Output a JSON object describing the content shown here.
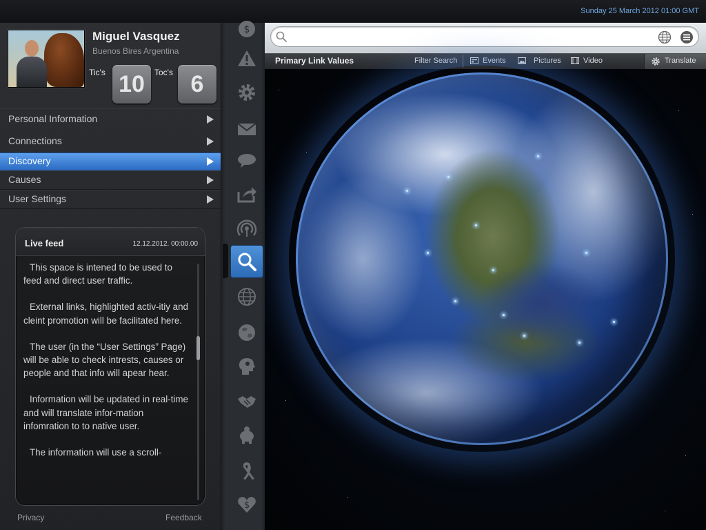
{
  "topbar": {
    "datetime": "Sunday 25 March 2012 01:00 GMT"
  },
  "profile": {
    "name": "Miguel Vasquez",
    "location": "Buenos Bires Argentina",
    "tics_label": "Tic's",
    "tics_value": "10",
    "tocs_label": "Toc's",
    "tocs_value": "6"
  },
  "nav": {
    "items": [
      {
        "label": "Personal Information"
      },
      {
        "label": "Connections"
      },
      {
        "label": "Discovery",
        "active": true
      },
      {
        "label": "Causes"
      },
      {
        "label": "User Settings"
      }
    ]
  },
  "feed": {
    "title": "Live feed",
    "date": "12.12.2012.   00:00.00",
    "paragraphs": [
      "This space is intened to be used to feed and direct user traffic.",
      "External links, highlighted activ-itiy and cleint promotion will be facilitated here.",
      "The user (in the “User Settings” Page) will be able to check intrests, causes or people and that info will apear hear.",
      "Information will be updated in real-time and will translate infor-mation infomration to to native user.",
      "The information will use a scroll-"
    ]
  },
  "footer": {
    "privacy": "Privacy",
    "feedback": "Feedback"
  },
  "strip_icons": [
    "dollar-icon",
    "warning-icon",
    "gear-icon",
    "mail-icon",
    "speech-bubble-icon",
    "share-icon",
    "broadcast-icon",
    "search-icon",
    "globe-grid-icon",
    "globe-icon",
    "head-gears-icon",
    "handshake-icon",
    "piggy-bank-icon",
    "ribbon-icon",
    "heart-dollar-icon"
  ],
  "search": {
    "placeholder": "",
    "value": ""
  },
  "toolbar": {
    "primary": "Primary Link Values",
    "filter": "Filter Search",
    "events": "Events",
    "pictures": "Pictures",
    "video": "Video",
    "translate": "Translate"
  },
  "colors": {
    "accent": "#3a7fd0",
    "datetime": "#6fa4df"
  }
}
